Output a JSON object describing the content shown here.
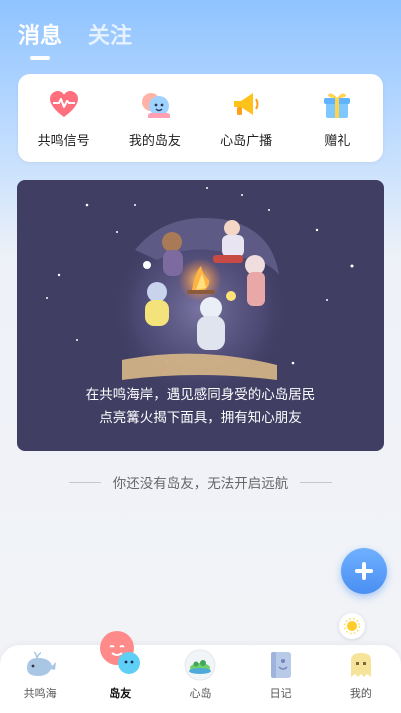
{
  "header": {
    "tabs": [
      {
        "label": "消息",
        "active": true
      },
      {
        "label": "关注",
        "active": false
      }
    ]
  },
  "quick_actions": [
    {
      "label": "共鸣信号",
      "icon": "heart-pulse-icon"
    },
    {
      "label": "我的岛友",
      "icon": "friends-icon"
    },
    {
      "label": "心岛广播",
      "icon": "megaphone-icon"
    },
    {
      "label": "赠礼",
      "icon": "gift-icon"
    }
  ],
  "banner": {
    "line1": "在共鸣海岸，遇见感同身受的心岛居民",
    "line2": "点亮篝火揭下面具，拥有知心朋友"
  },
  "notice": "你还没有岛友，无法开启远航",
  "bottom_nav": [
    {
      "label": "共鸣海",
      "icon": "whale-icon",
      "active": false
    },
    {
      "label": "岛友",
      "icon": "island-friend-icon",
      "active": true
    },
    {
      "label": "心岛",
      "icon": "island-icon",
      "active": false
    },
    {
      "label": "日记",
      "icon": "diary-icon",
      "active": false
    },
    {
      "label": "我的",
      "icon": "profile-ghost-icon",
      "active": false
    }
  ],
  "colors": {
    "accent": "#4a8ff2",
    "banner_bg": "#403e63"
  }
}
